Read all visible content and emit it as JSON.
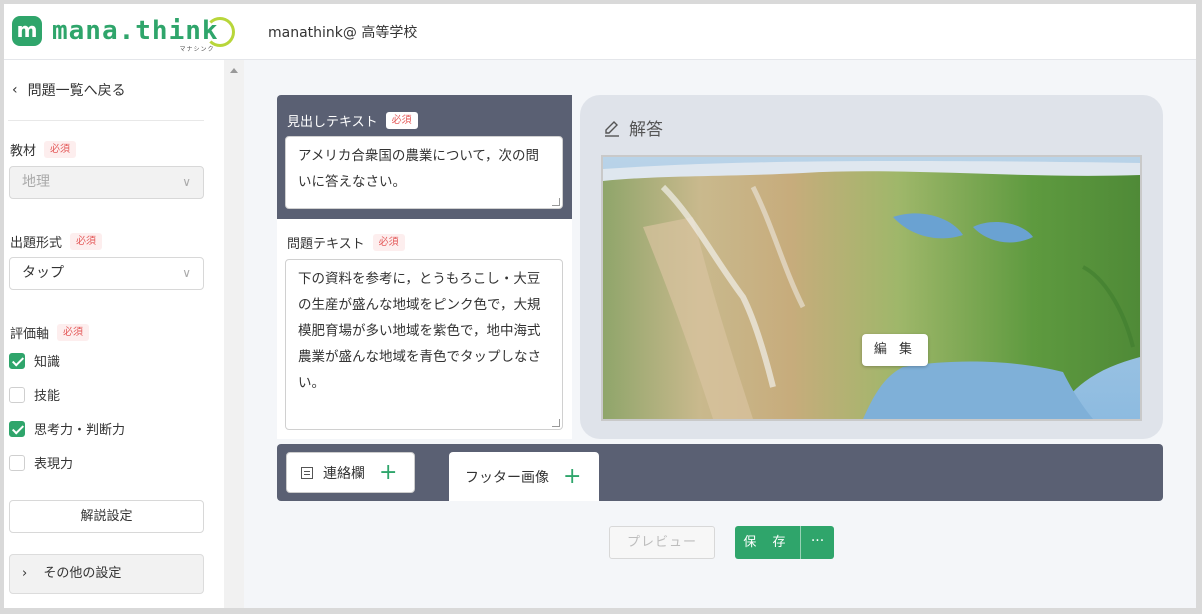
{
  "header": {
    "logo_letter": "m",
    "logo_text": "mana.think",
    "logo_sub": "マナシンク",
    "org": "manathink@ 高等学校"
  },
  "sidebar": {
    "back_label": "問題一覧へ戻る",
    "required_badge": "必須",
    "subject": {
      "label": "教材",
      "value": "地理"
    },
    "format": {
      "label": "出題形式",
      "value": "タップ"
    },
    "criteria": {
      "label": "評価軸",
      "items": [
        {
          "label": "知識",
          "checked": true
        },
        {
          "label": "技能",
          "checked": false
        },
        {
          "label": "思考力・判断力",
          "checked": true
        },
        {
          "label": "表現力",
          "checked": false
        }
      ]
    },
    "explanation_button": "解説設定",
    "other_settings": "その他の設定"
  },
  "editor": {
    "heading_label": "見出しテキスト",
    "heading_text": "アメリカ合衆国の農業について，次の問いに答えなさい。",
    "question_label": "問題テキスト",
    "question_text": "下の資料を参考に，とうもろこし・大豆の生産が盛んな地域をピンク色で，大規模肥育場が多い地域を紫色で，地中海式農業が盛んな地域を青色でタップしなさい。",
    "answer_label": "解答",
    "edit_button": "編 集",
    "contact_tab": "連絡欄",
    "footer_tab": "フッター画像",
    "preview_button": "プレビュー",
    "save_button": "保 存",
    "more_button": "···"
  },
  "colors": {
    "brand": "#2fa56b",
    "dark_panel": "#5a6073",
    "required": "#e45a5a"
  }
}
